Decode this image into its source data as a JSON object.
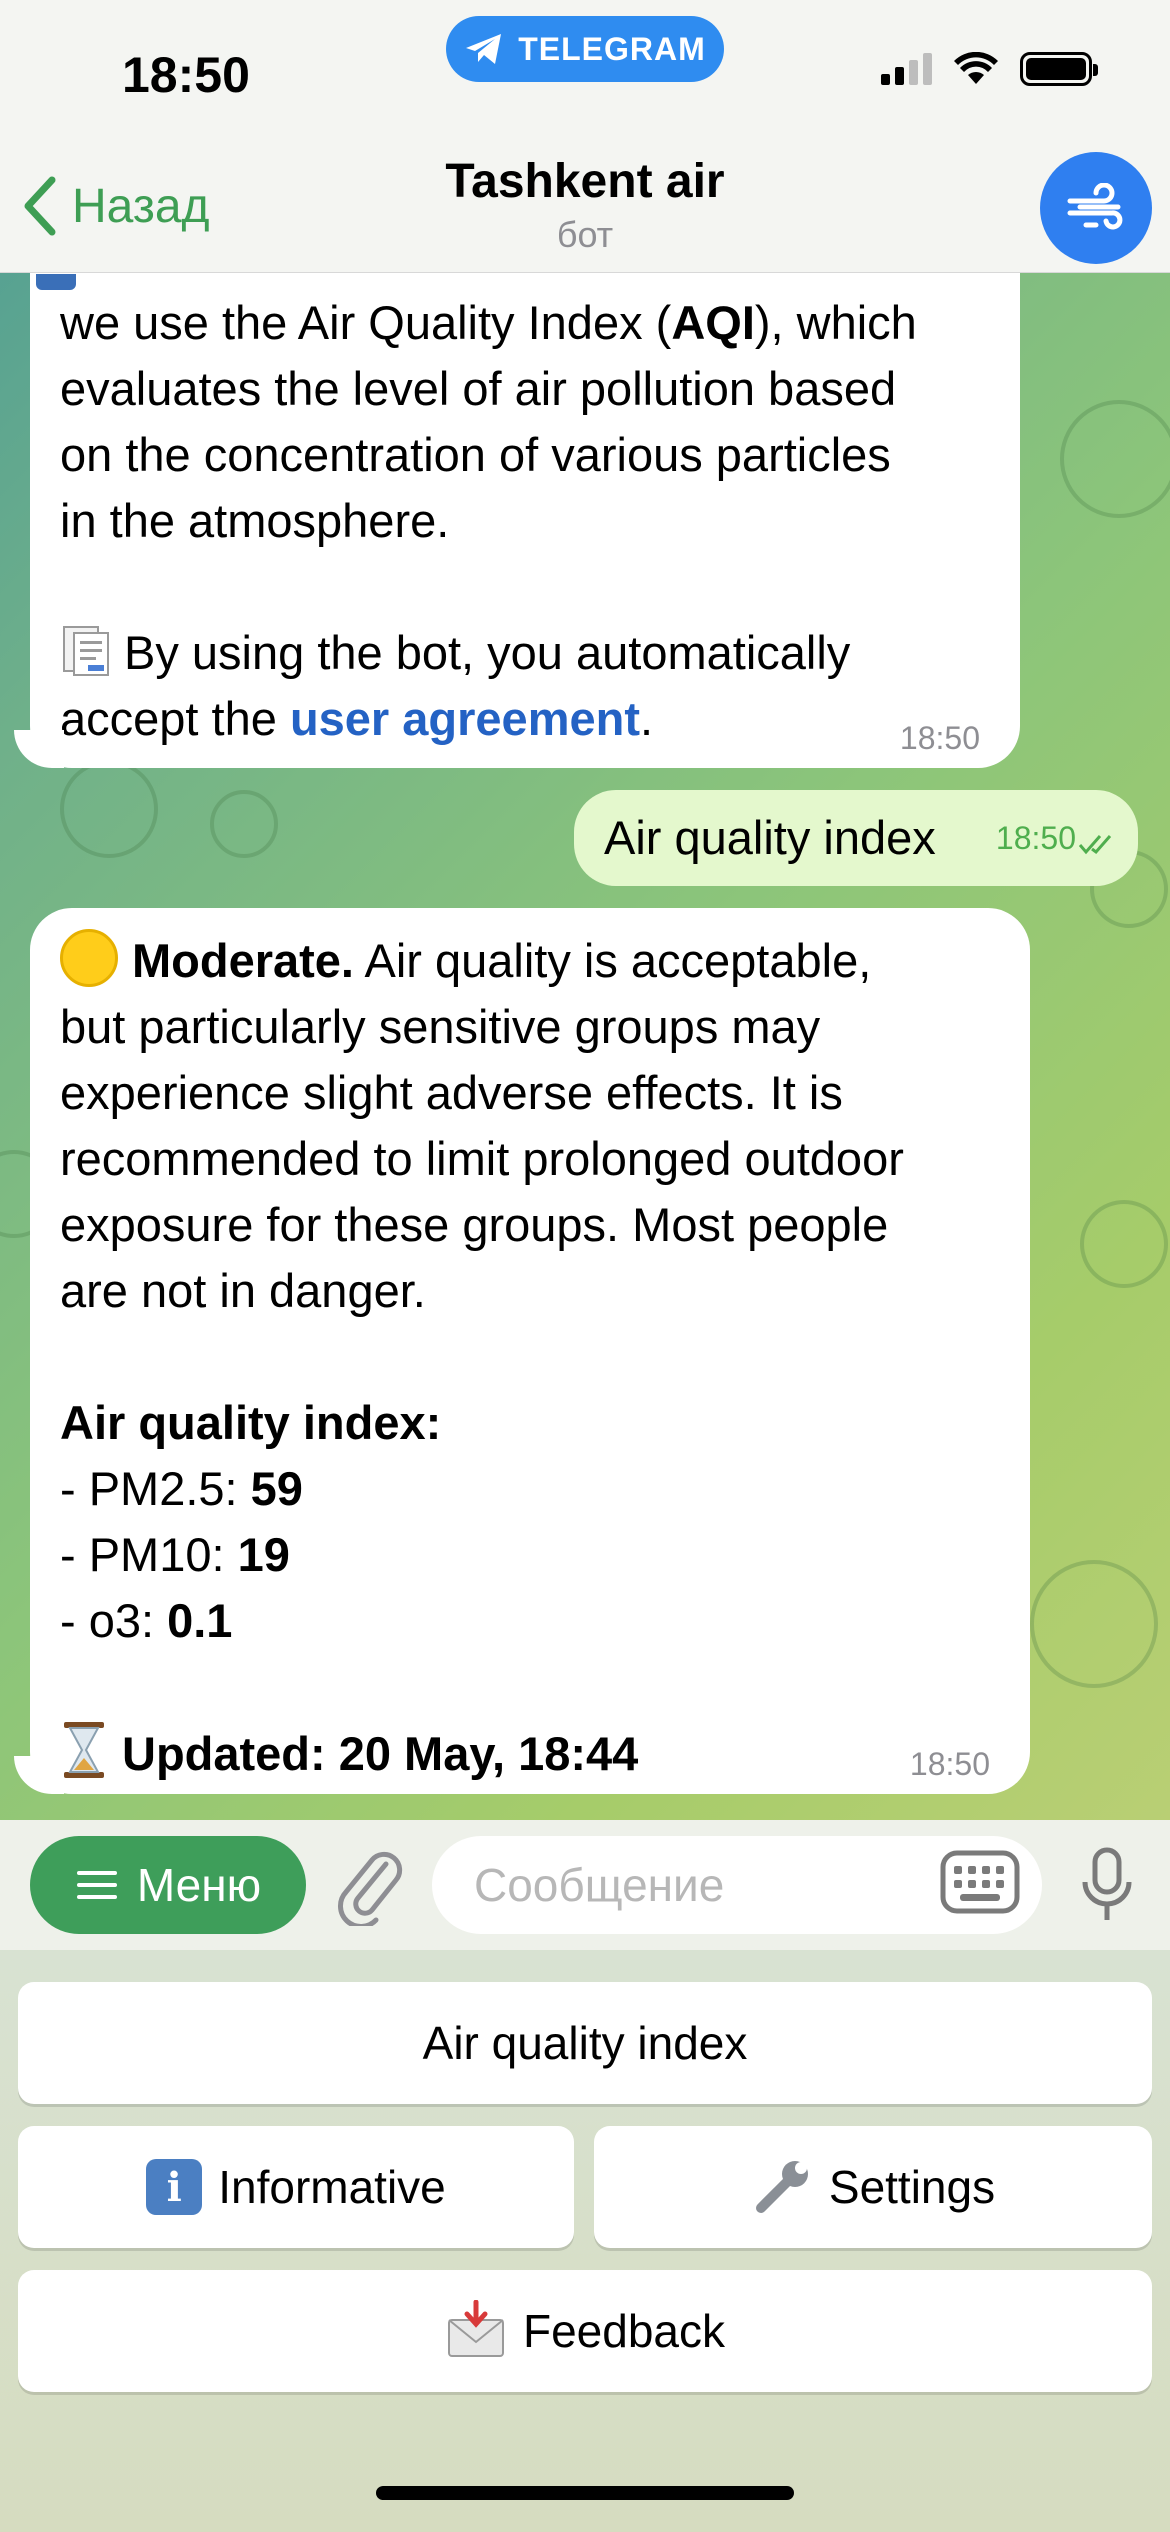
{
  "status_bar": {
    "time": "18:50",
    "pill_label": "TELEGRAM"
  },
  "header": {
    "back_label": "Назад",
    "title": "Tashkent air",
    "subtitle": "бот"
  },
  "messages": [
    {
      "direction": "incoming",
      "lines": [
        "we use the Air Quality Index (",
        "AQI",
        "), which",
        "evaluates the level of air pollution based",
        "on the concentration of various particles",
        "in the atmosphere."
      ],
      "agreement_prefix": "By using the bot, you automatically",
      "agreement_line2_prefix": "accept the ",
      "agreement_link": "user agreement",
      "agreement_suffix": ".",
      "time": "18:50"
    },
    {
      "direction": "outgoing",
      "text": "Air quality index",
      "time": "18:50"
    },
    {
      "direction": "incoming",
      "status_word": "Moderate.",
      "status_rest": " Air quality is acceptable,",
      "body_lines": [
        "but particularly sensitive groups may",
        "experience slight adverse effects. It is",
        "recommended to limit prolonged outdoor",
        "exposure for these groups. Most people",
        "are not in danger."
      ],
      "index_heading": "Air quality index:",
      "readings": [
        {
          "label": "- PM2.5: ",
          "value": "59"
        },
        {
          "label": "- PM10: ",
          "value": "19"
        },
        {
          "label": "- o3: ",
          "value": "0.1"
        }
      ],
      "updated": "Updated: 20 May, 18:44",
      "time": "18:50"
    }
  ],
  "composer": {
    "menu_label": "Меню",
    "placeholder": "Сообщение"
  },
  "keyboard": {
    "row1": "Air quality index",
    "informative": "Informative",
    "settings": "Settings",
    "feedback": "Feedback"
  },
  "colors": {
    "accent_green": "#3e9e5a",
    "link_blue": "#2462c4",
    "telegram_blue": "#2f8cf0"
  }
}
